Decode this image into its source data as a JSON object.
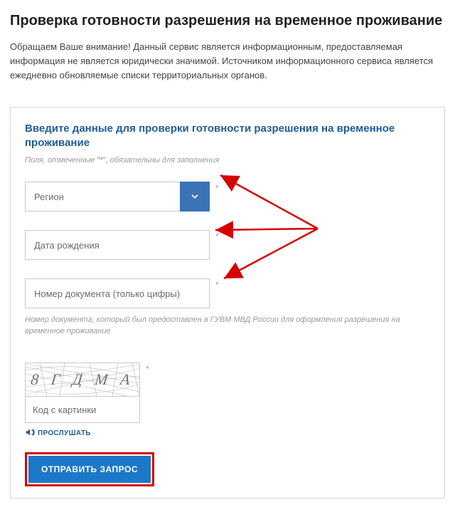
{
  "page": {
    "title": "Проверка готовности разрешения на временное проживание",
    "intro": "Обращаем Ваше внимание! Данный сервис является информационным, предоставляемая информация не является юридически значимой. Источником информационного сервиса является ежедневно обновляемые списки территориальных органов."
  },
  "form": {
    "heading": "Введите данные для проверки готовности разрешения на временное проживание",
    "required_hint_prefix": "Поля, отмеченные ",
    "required_hint_marker": "\"*\"",
    "required_hint_suffix": ", обязательны для заполнения",
    "fields": {
      "region": {
        "placeholder": "Регион"
      },
      "dob": {
        "placeholder": "Дата рождения"
      },
      "doc": {
        "placeholder": "Номер документа (только цифры)",
        "hint": "Номер документа, который был предоставлен в ГУВМ МВД России для оформления разрешения на временное проживание"
      }
    },
    "captcha": {
      "value": "8 Г Д М А",
      "input_placeholder": "Код с картинки",
      "listen_label": "ПРОСЛУШАТЬ"
    },
    "submit_label": "ОТПРАВИТЬ ЗАПРОС"
  },
  "colors": {
    "accent_blue": "#1d78c9",
    "heading_blue": "#1d5d9b",
    "dropdown_blue": "#3a74b5",
    "annotation_red": "#d60000"
  }
}
